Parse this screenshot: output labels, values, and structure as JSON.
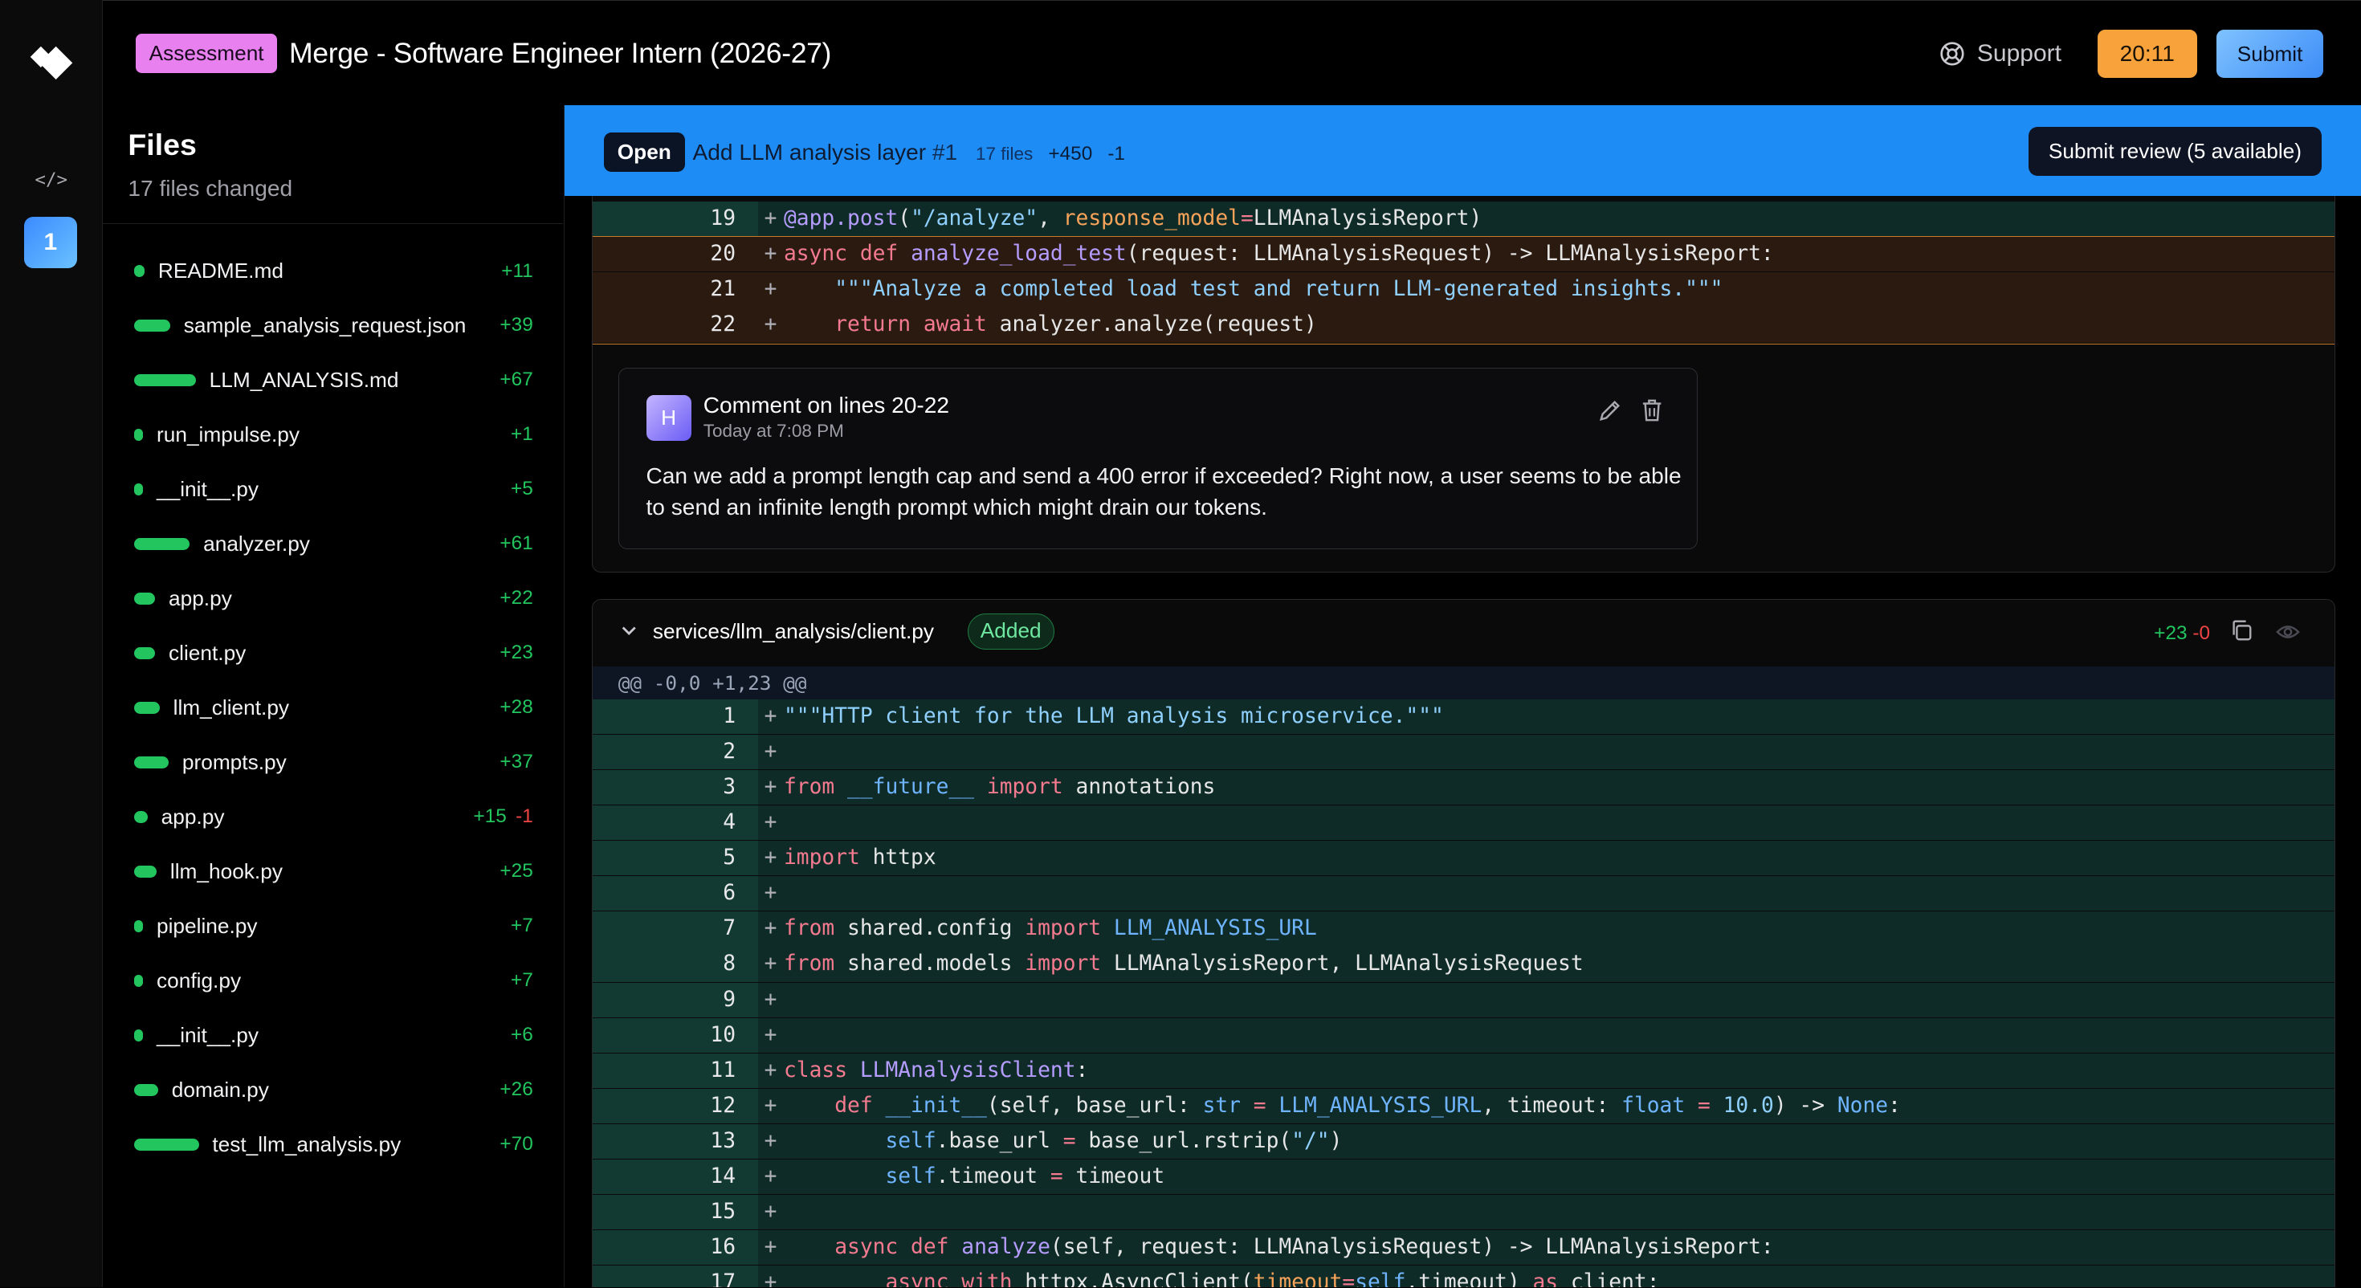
{
  "header": {
    "badge": "Assessment",
    "title": "Merge - Software Engineer Intern (2026-27)",
    "support": "Support",
    "timer": "20:11",
    "submit": "Submit"
  },
  "rail": {
    "code_icon": "</>",
    "active_number": "1"
  },
  "files_panel": {
    "title": "Files",
    "subtitle": "17 files changed",
    "files": [
      {
        "name": "README.md",
        "add": "+11",
        "del": "",
        "bar": 11
      },
      {
        "name": "sample_analysis_request.json",
        "add": "+39",
        "del": "",
        "bar": 39
      },
      {
        "name": "LLM_ANALYSIS.md",
        "add": "+67",
        "del": "",
        "bar": 67
      },
      {
        "name": "run_impulse.py",
        "add": "+1",
        "del": "",
        "bar": 1
      },
      {
        "name": "__init__.py",
        "add": "+5",
        "del": "",
        "bar": 5
      },
      {
        "name": "analyzer.py",
        "add": "+61",
        "del": "",
        "bar": 61
      },
      {
        "name": "app.py",
        "add": "+22",
        "del": "",
        "bar": 22
      },
      {
        "name": "client.py",
        "add": "+23",
        "del": "",
        "bar": 23
      },
      {
        "name": "llm_client.py",
        "add": "+28",
        "del": "",
        "bar": 28
      },
      {
        "name": "prompts.py",
        "add": "+37",
        "del": "",
        "bar": 37
      },
      {
        "name": "app.py",
        "add": "+15",
        "del": "-1",
        "bar": 15
      },
      {
        "name": "llm_hook.py",
        "add": "+25",
        "del": "",
        "bar": 25
      },
      {
        "name": "pipeline.py",
        "add": "+7",
        "del": "",
        "bar": 7
      },
      {
        "name": "config.py",
        "add": "+7",
        "del": "",
        "bar": 7
      },
      {
        "name": "__init__.py",
        "add": "+6",
        "del": "",
        "bar": 6
      },
      {
        "name": "domain.py",
        "add": "+26",
        "del": "",
        "bar": 26
      },
      {
        "name": "test_llm_analysis.py",
        "add": "+70",
        "del": "",
        "bar": 70
      }
    ]
  },
  "pr": {
    "status": "Open",
    "title": "Add LLM analysis layer",
    "number": "#1",
    "files": "17 files",
    "additions": "+450",
    "deletions": "-1",
    "submit_review": "Submit review (5 available)"
  },
  "diff1": {
    "lines": [
      {
        "n": "19",
        "style": "green",
        "html": "<span class='dec'>@app.post</span>(<span class='str'>\"/analyze\"</span>, <span class='param'>response_model</span><span class='kw'>=</span>LLMAnalysisReport)"
      },
      {
        "n": "20",
        "style": "brown",
        "html": "<span class='kw'>async def</span> <span class='fn'>analyze_load_test</span>(request: LLMAnalysisRequest) -> LLMAnalysisReport:"
      },
      {
        "n": "21",
        "style": "brown",
        "html": "    <span class='str'>\"\"\"Analyze a completed load test and return LLM-generated insights.\"\"\"</span>"
      },
      {
        "n": "22",
        "style": "brown",
        "html": "    <span class='kw'>return await</span> analyzer.analyze(request)"
      }
    ]
  },
  "comment": {
    "avatar": "H",
    "title": "Comment on lines 20-22",
    "time": "Today at 7:08 PM",
    "body": "Can we add a prompt length cap and send a 400 error if exceeded? Right now, a user seems to be able to send an infinite length prompt which might drain our tokens."
  },
  "diff2": {
    "path": "services/llm_analysis/client.py",
    "status": "Added",
    "additions": "+23",
    "deletions": "-0",
    "hunk": "@@ -0,0 +1,23 @@",
    "lines": [
      {
        "n": "1",
        "html": "<span class='str'>\"\"\"HTTP client for the LLM analysis microservice.\"\"\"</span>"
      },
      {
        "n": "2",
        "html": ""
      },
      {
        "n": "3",
        "html": "<span class='kw'>from</span> <span class='blue'>__future__</span> <span class='kw'>import</span> annotations"
      },
      {
        "n": "4",
        "html": ""
      },
      {
        "n": "5",
        "html": "<span class='kw'>import</span> httpx"
      },
      {
        "n": "6",
        "html": ""
      },
      {
        "n": "7",
        "html": "<span class='kw'>from</span> shared.config <span class='kw'>import</span> <span class='blue'>LLM_ANALYSIS_URL</span>"
      },
      {
        "n": "8",
        "html": "<span class='kw'>from</span> shared.models <span class='kw'>import</span> LLMAnalysisReport, LLMAnalysisRequest"
      },
      {
        "n": "9",
        "html": ""
      },
      {
        "n": "10",
        "html": ""
      },
      {
        "n": "11",
        "html": "<span class='kw'>class</span> <span class='fn'>LLMAnalysisClient</span>:"
      },
      {
        "n": "12",
        "html": "    <span class='kw'>def</span> <span class='blue'>__init__</span>(self, base_url: <span class='blue'>str</span> <span class='kw'>=</span> <span class='blue'>LLM_ANALYSIS_URL</span>, timeout: <span class='blue'>float</span> <span class='kw'>=</span> <span class='num'>10.0</span>) -> <span class='blue'>None</span>:"
      },
      {
        "n": "13",
        "html": "        <span class='blue'>self</span>.base_url <span class='kw'>=</span> base_url.rstrip(<span class='str'>\"/\"</span>)"
      },
      {
        "n": "14",
        "html": "        <span class='blue'>self</span>.timeout <span class='kw'>=</span> timeout"
      },
      {
        "n": "15",
        "html": ""
      },
      {
        "n": "16",
        "html": "    <span class='kw'>async def</span> <span class='fn'>analyze</span>(self, request: LLMAnalysisRequest) -> LLMAnalysisReport:"
      },
      {
        "n": "17",
        "html": "        <span class='kw'>async with</span> httpx.AsyncClient(<span class='param'>timeout</span><span class='kw'>=</span><span class='blue'>self</span>.timeout) <span class='kw'>as</span> client:"
      }
    ]
  },
  "colors": {
    "accent_blue": "#1e8cf5",
    "timer_orange": "#f7a23a",
    "badge_pink": "#e880f0",
    "add_green": "#22c55e",
    "del_red": "#ef4444",
    "diff_green_bg": "#0e2b27",
    "comment_highlight_bg": "#2a1a10"
  },
  "icons": [
    "logo-icon",
    "code-icon",
    "support-icon",
    "edit-icon",
    "trash-icon",
    "chevron-down-icon",
    "copy-icon",
    "eye-icon"
  ]
}
